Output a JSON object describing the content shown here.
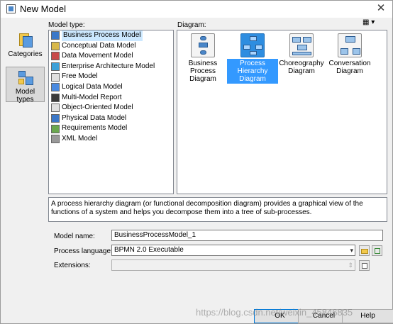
{
  "window": {
    "title": "New Model",
    "close_glyph": "✕"
  },
  "categories_pane": {
    "items": [
      {
        "label": "Categories",
        "icon": "categories-icon",
        "selected": false
      },
      {
        "label": "Model types",
        "icon": "model-types-icon",
        "selected": true
      }
    ]
  },
  "model_type": {
    "label": "Model type:",
    "items": [
      {
        "label": "Business Process Model",
        "icon": "business-process-model-icon",
        "color": "#3c78c8",
        "selected": true
      },
      {
        "label": "Conceptual Data Model",
        "icon": "conceptual-data-model-icon",
        "color": "#d8b84a",
        "selected": false
      },
      {
        "label": "Data Movement Model",
        "icon": "data-movement-model-icon",
        "color": "#c84a4a",
        "selected": false
      },
      {
        "label": "Enterprise Architecture Model",
        "icon": "enterprise-architecture-model-icon",
        "color": "#3ca0d8",
        "selected": false
      },
      {
        "label": "Free Model",
        "icon": "free-model-icon",
        "color": "#e0e0e0",
        "selected": false
      },
      {
        "label": "Logical Data Model",
        "icon": "logical-data-model-icon",
        "color": "#4a8ae0",
        "selected": false
      },
      {
        "label": "Multi-Model Report",
        "icon": "multi-model-report-icon",
        "color": "#3a3a3a",
        "selected": false
      },
      {
        "label": "Object-Oriented Model",
        "icon": "object-oriented-model-icon",
        "color": "#e0e0e0",
        "selected": false
      },
      {
        "label": "Physical Data Model",
        "icon": "physical-data-model-icon",
        "color": "#3c78c8",
        "selected": false
      },
      {
        "label": "Requirements Model",
        "icon": "requirements-model-icon",
        "color": "#6aa84f",
        "selected": false
      },
      {
        "label": "XML Model",
        "icon": "xml-model-icon",
        "color": "#999999",
        "selected": false
      }
    ]
  },
  "diagram": {
    "label": "Diagram:",
    "view_icon": "view-options-icon",
    "view_glyph": "▦ ▾",
    "items": [
      {
        "label": "Business Process Diagram",
        "icon": "business-process-diagram-icon",
        "selected": false
      },
      {
        "label": "Process Hierarchy Diagram",
        "icon": "process-hierarchy-diagram-icon",
        "selected": true
      },
      {
        "label": "Choreography Diagram",
        "icon": "choreography-diagram-icon",
        "selected": false
      },
      {
        "label": "Conversation Diagram",
        "icon": "conversation-diagram-icon",
        "selected": false
      }
    ]
  },
  "description": "A process hierarchy diagram (or functional decomposition diagram) provides a graphical view of the functions of a system and helps you decompose them into a tree of sub-processes.",
  "form": {
    "model_name_label": "Model name:",
    "model_name_value": "BusinessProcessModel_1",
    "process_language_label": "Process language:",
    "process_language_value": "BPMN 2.0 Executable",
    "extensions_label": "Extensions:",
    "extensions_value": ""
  },
  "buttons": {
    "ok": "OK",
    "cancel": "Cancel",
    "help": "Help"
  },
  "watermark": "https://blog.csdn.net/weixin_45846835"
}
